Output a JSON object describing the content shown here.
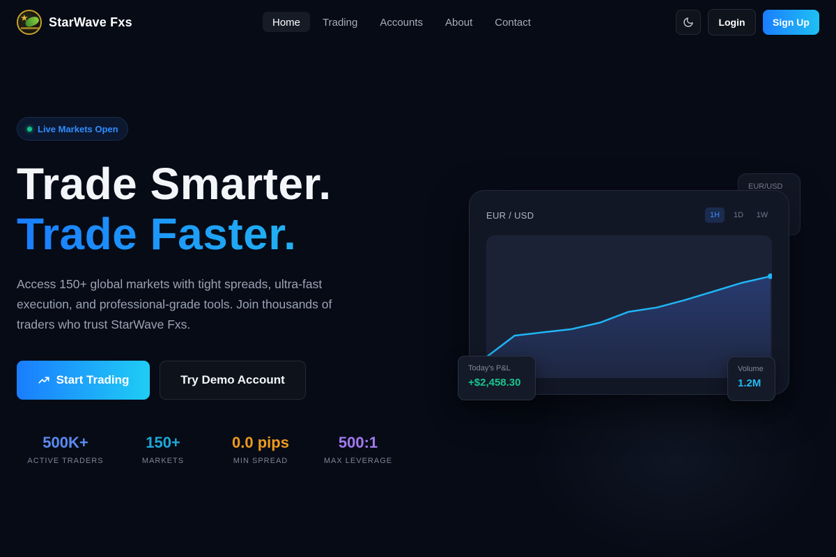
{
  "brand": {
    "name": "StarWave Fxs"
  },
  "nav": {
    "links": [
      {
        "label": "Home",
        "active": true
      },
      {
        "label": "Trading",
        "active": false
      },
      {
        "label": "Accounts",
        "active": false
      },
      {
        "label": "About",
        "active": false
      },
      {
        "label": "Contact",
        "active": false
      }
    ],
    "login_label": "Login",
    "signup_label": "Sign Up",
    "theme_icon": "moon-icon"
  },
  "hero": {
    "badge": "Live Markets Open",
    "title_line1": "Trade Smarter.",
    "title_line2": "Trade Faster.",
    "lead": "Access 150+ global markets with tight spreads, ultra-fast execution, and professional-grade tools. Join thousands of traders who trust StarWave Fxs.",
    "cta_primary": "Start Trading",
    "cta_primary_icon": "trending-up-icon",
    "cta_secondary": "Try Demo Account"
  },
  "stats": [
    {
      "value": "500K+",
      "label": "ACTIVE TRADERS",
      "color": "#5b8cf0"
    },
    {
      "value": "150+",
      "label": "MARKETS",
      "color": "#1ea9d8"
    },
    {
      "value": "0.0 pips",
      "label": "MIN SPREAD",
      "color": "#f09a1e"
    },
    {
      "value": "500:1",
      "label": "MAX LEVERAGE",
      "color": "#a27af0"
    }
  ],
  "chart_card": {
    "pair": "EUR / USD",
    "timeframes": [
      {
        "label": "1H",
        "active": true
      },
      {
        "label": "1D",
        "active": false
      },
      {
        "label": "1W",
        "active": false
      }
    ],
    "back_card_label": "EUR/USD",
    "pnl_label": "Today's P&L",
    "pnl_value": "+$2,458.30",
    "volume_label": "Volume",
    "volume_value": "1.2M"
  },
  "chart_data": {
    "type": "area",
    "series": [
      {
        "values": [
          0.0,
          0.2,
          0.23,
          0.26,
          0.32,
          0.42,
          0.46,
          0.53,
          0.61,
          0.69,
          0.75
        ]
      }
    ],
    "ylim": [
      0,
      1
    ],
    "line_color": "#1fb6f5",
    "fill_color": "#2a3f7a"
  },
  "colors": {
    "accent": "#1a7dff",
    "accent2": "#1fc0f3",
    "success": "#18c48e",
    "background": "#070b16"
  }
}
